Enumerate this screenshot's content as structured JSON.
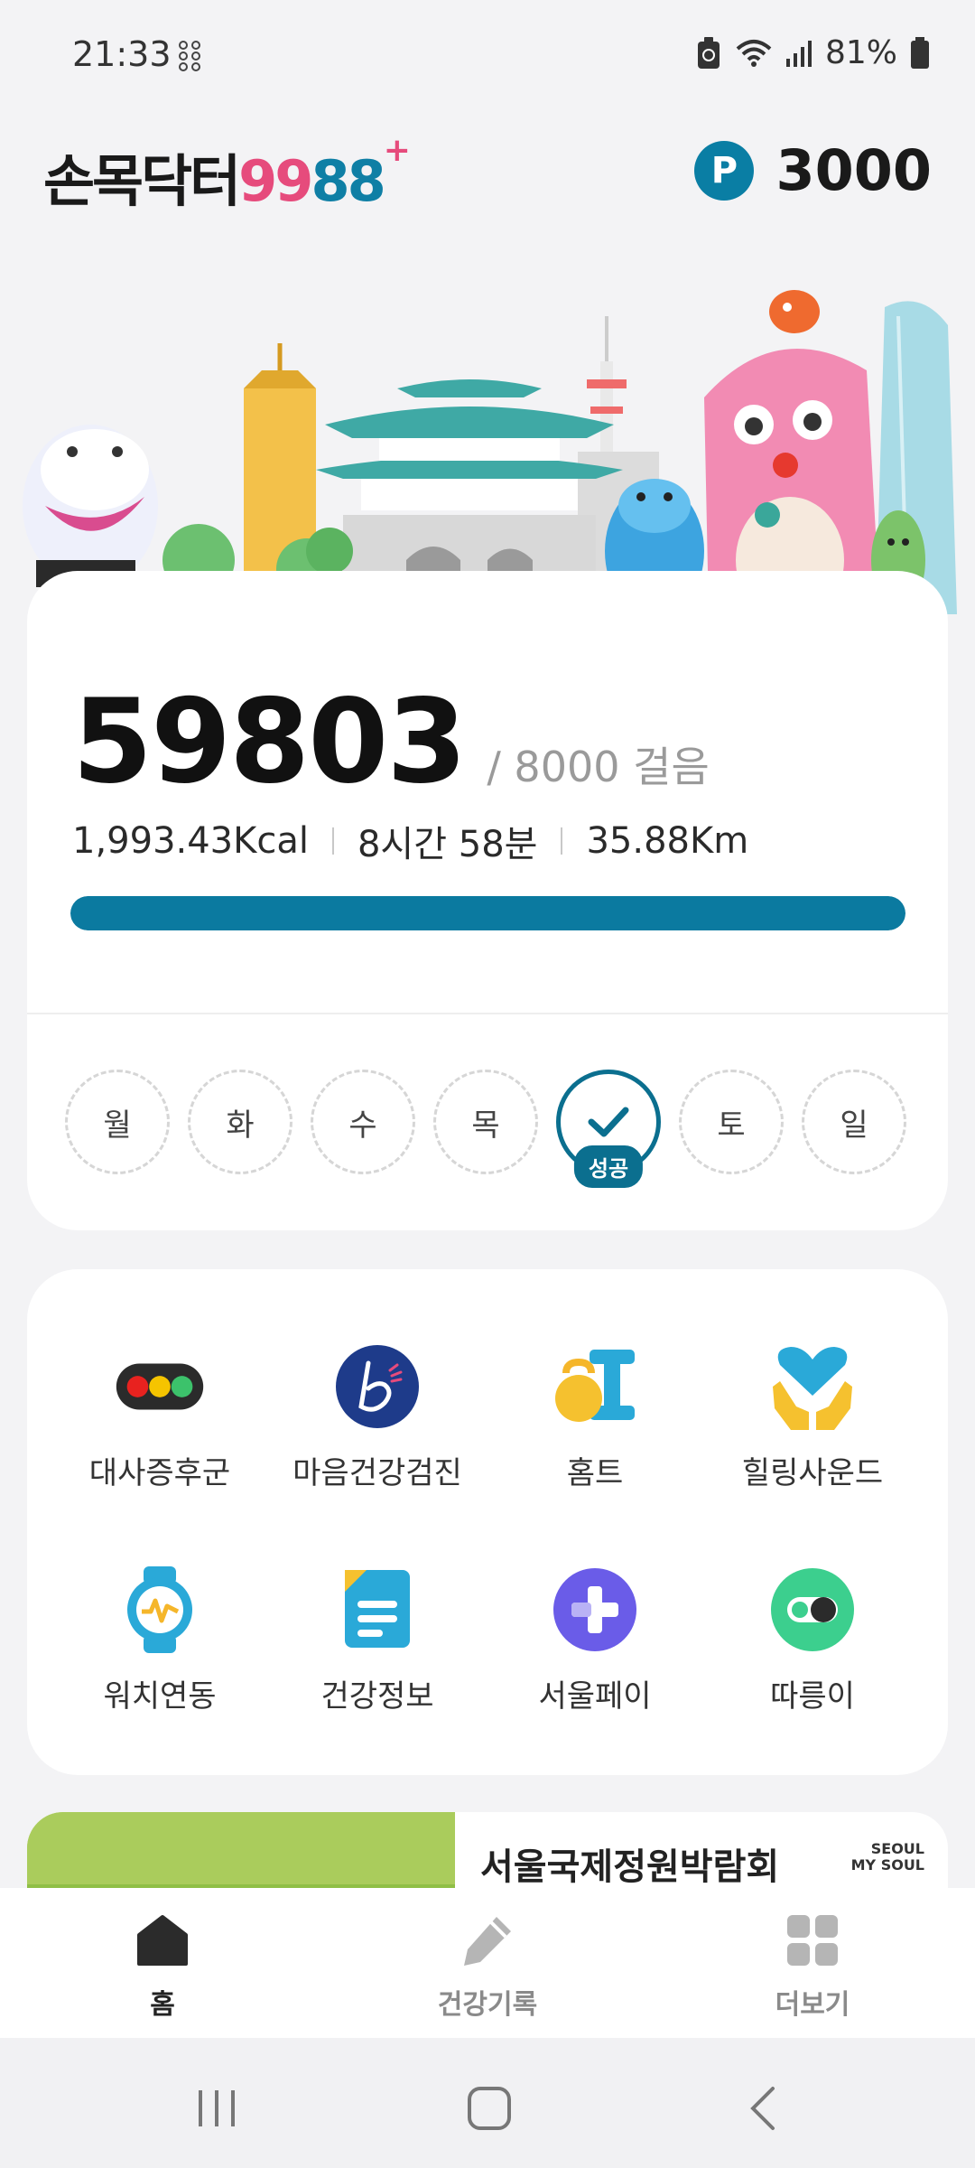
{
  "status_bar": {
    "time": "21:33",
    "battery": "81%"
  },
  "header": {
    "logo_main": "손목닥터",
    "logo_9": "99",
    "logo_88": "88",
    "logo_plus": "+",
    "points_badge": "P",
    "points": "3000"
  },
  "steps": {
    "count": "59803",
    "goal": "/ 8000 걸음",
    "kcal": "1,993.43Kcal",
    "time": "8시간 58분",
    "distance": "35.88Km",
    "progress_fraction": 1.0
  },
  "week": {
    "days": [
      "월",
      "화",
      "수",
      "목",
      "금",
      "토",
      "일"
    ],
    "completed_day": "금",
    "success_label": "성공"
  },
  "menu": {
    "items": [
      {
        "label": "대사증후군",
        "icon": "traffic-light-icon"
      },
      {
        "label": "마음건강검진",
        "icon": "mind-b-icon"
      },
      {
        "label": "홈트",
        "icon": "kettlebell-dumbbell-icon"
      },
      {
        "label": "힐링사운드",
        "icon": "heart-hands-icon"
      },
      {
        "label": "워치연동",
        "icon": "smartwatch-icon"
      },
      {
        "label": "건강정보",
        "icon": "document-icon"
      },
      {
        "label": "서울페이",
        "icon": "plus-circle-icon"
      },
      {
        "label": "따릉이",
        "icon": "bike-toggle-icon"
      }
    ]
  },
  "banner": {
    "title": "서울국제정원박람회",
    "tag_line1": "SEOUL",
    "tag_line2": "MY SOUL"
  },
  "bottom_nav": {
    "items": [
      {
        "label": "홈",
        "icon": "home-icon",
        "active": true
      },
      {
        "label": "건강기록",
        "icon": "pencil-icon",
        "active": false
      },
      {
        "label": "더보기",
        "icon": "grid-icon",
        "active": false
      }
    ]
  },
  "colors": {
    "accent": "#0b7aa0",
    "brand_pink": "#e64b7c",
    "background": "#f3f3f5"
  }
}
